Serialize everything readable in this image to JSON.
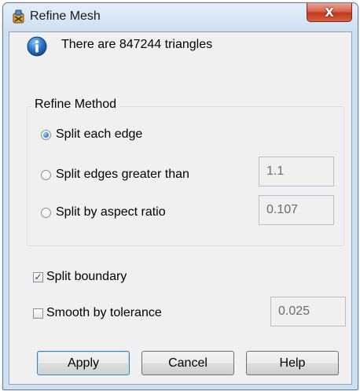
{
  "window": {
    "title": "Refine Mesh",
    "close_label": "X",
    "title_icon": "tool-app-icon",
    "close_color": "#c7402a"
  },
  "info": {
    "icon": "info-icon",
    "message": "There are 847244 triangles"
  },
  "refine_method": {
    "legend": "Refine Method",
    "options": [
      {
        "label": "Split each edge",
        "selected": true
      },
      {
        "label": "Split edges greater than",
        "selected": false,
        "value": "1.1"
      },
      {
        "label": "Split by aspect ratio",
        "selected": false,
        "value": "0.107"
      }
    ]
  },
  "split_boundary": {
    "label": "Split boundary",
    "checked": true
  },
  "smooth": {
    "label": "Smooth by tolerance",
    "checked": false,
    "value": "0.025"
  },
  "buttons": {
    "apply": "Apply",
    "cancel": "Cancel",
    "help": "Help"
  },
  "colors": {
    "window_frame": "#cfe0f2",
    "client_bg": "#f0f0f0",
    "accent": "#2c76c5"
  }
}
